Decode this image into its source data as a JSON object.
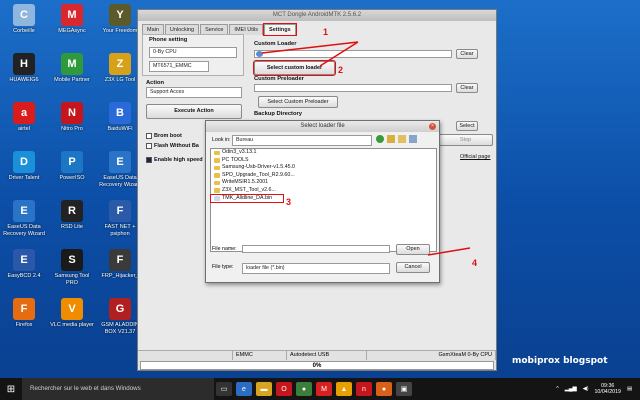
{
  "desktop": {
    "icons_left": [
      {
        "label": "Corbeille",
        "icon": "recycle-bin-icon",
        "color": "#8fb7de"
      },
      {
        "label": "HUAWEIG6",
        "icon": "phone-icon",
        "color": "#222"
      },
      {
        "label": "airtel",
        "icon": "airtel-icon",
        "color": "#d91c1c"
      },
      {
        "label": "Driver Talent",
        "icon": "driver-talent-icon",
        "color": "#1b90d8"
      },
      {
        "label": "EaseUS Data Recovery Wizard",
        "icon": "easeus-icon",
        "color": "#2a74c8"
      },
      {
        "label": "EasyBCD 2.4",
        "icon": "easybcd-icon",
        "color": "#2b57a8"
      },
      {
        "label": "Firefox",
        "icon": "firefox-icon",
        "color": "#e66c12"
      }
    ],
    "icons_col2": [
      {
        "label": "MEGAsync",
        "icon": "mega-icon",
        "color": "#d9272e"
      },
      {
        "label": "Mobile Partner",
        "icon": "mobile-partner-icon",
        "color": "#2e9a3c"
      },
      {
        "label": "Nitro Pro",
        "icon": "nitro-icon",
        "color": "#c4161c"
      },
      {
        "label": "PowerISO",
        "icon": "poweriso-icon",
        "color": "#1c76c4"
      },
      {
        "label": "RSD Lite",
        "icon": "rsd-lite-icon",
        "color": "#222"
      },
      {
        "label": "Samsung Tool PRO",
        "icon": "samsung-tool-icon",
        "color": "#1a1a1a"
      },
      {
        "label": "VLC media player",
        "icon": "vlc-icon",
        "color": "#f08c00"
      }
    ],
    "icons_col3": [
      {
        "label": "Your Freedom",
        "icon": "your-freedom-icon",
        "color": "#5a5a2a"
      },
      {
        "label": "Z3X LG Tool",
        "icon": "z3x-icon",
        "color": "#d7a21a"
      },
      {
        "label": "BaiduWiFi",
        "icon": "baiduwifi-icon",
        "color": "#2a6ad8"
      },
      {
        "label": "EaseUS Data Recovery Wizard",
        "icon": "easeus-icon",
        "color": "#2a74c8"
      },
      {
        "label": "FAST NET + psiphon",
        "icon": "fastnet-icon",
        "color": "#2a5aa8"
      },
      {
        "label": "FRP_Hijacker_",
        "icon": "frp-icon",
        "color": "#3a3a3a"
      },
      {
        "label": "GSM ALADDIN BOX V21.37",
        "icon": "gsm-aladdin-icon",
        "color": "#b02020"
      }
    ]
  },
  "app": {
    "title": "MCT Dongle AndroidMTK 2.5.6.2",
    "tabs": [
      "Main",
      "Unlocking",
      "Service",
      "IMEI Utils",
      "Settings"
    ],
    "phone_setting_label": "Phone setting",
    "cpu": "0-By CPU",
    "model": "MT6571_EMMC",
    "action_label": "Action",
    "action_value": "Support Acces",
    "execute_label": "Execute Action",
    "brom_boot": "Brom boot",
    "flash_without_battery": "Flash Without Ba",
    "enable_high_speed": "Enable high speed",
    "custom_loader_label": "Custom Loader",
    "clear": "Clear",
    "select_custom_loader": "Select custom loader",
    "custom_preloader_label": "Custom Preloader",
    "select_custom_preloader": "Select Custom Preloader",
    "backup_directory_label": "Backup Directory",
    "select": "Select",
    "stop": "Stop",
    "official_page": "Official page",
    "status": [
      "EMMC",
      "Autodetect USB",
      "GsmXteaM 0-By CPU"
    ],
    "progress": "0%"
  },
  "dialog": {
    "title": "Select loader file",
    "look_in_label": "Look in:",
    "look_in_value": "Bureau",
    "files": [
      {
        "name": "Odin3_v3.13.1",
        "type": "folder"
      },
      {
        "name": "PC TOOLS",
        "type": "folder"
      },
      {
        "name": "Samsung-Usb-Driver-v1.5.45.0",
        "type": "folder"
      },
      {
        "name": "SPD_Upgrade_Tool_R2.9.60...",
        "type": "folder"
      },
      {
        "name": "WriteMSIR1.5.2001",
        "type": "folder"
      },
      {
        "name": "Z3X_MST_Tool_v2.6...",
        "type": "folder"
      },
      {
        "name": "TMK_Alldline_DA.bin",
        "type": "bin"
      }
    ],
    "file_name_label": "File name:",
    "file_type_label": "File type:",
    "file_type_value": "loader file (*.bin)",
    "open": "Open",
    "cancel": "Cancel"
  },
  "annotations": [
    "1",
    "2",
    "3",
    "4"
  ],
  "taskbar": {
    "search": "Rechercher sur le web et dans Windows",
    "time": "09:36",
    "date": "10/04/2019"
  },
  "watermark": "mobiprox blogspot"
}
